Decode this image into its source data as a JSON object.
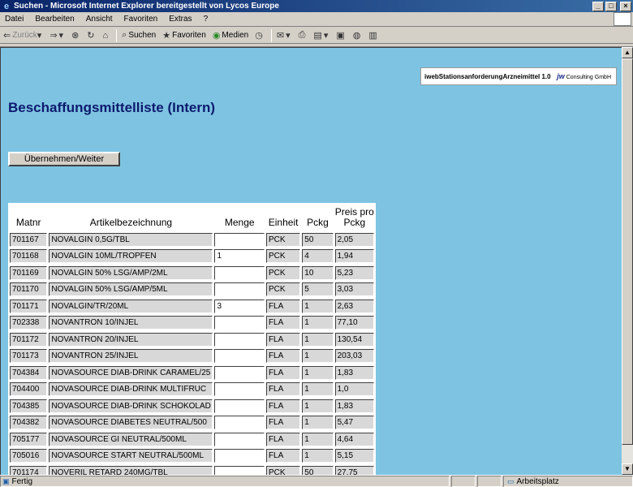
{
  "window": {
    "title": "Suchen - Microsoft Internet Explorer bereitgestellt von Lycos Europe",
    "min_label": "_",
    "max_label": "□",
    "close_label": "×"
  },
  "menubar": [
    "Datei",
    "Bearbeiten",
    "Ansicht",
    "Favoriten",
    "Extras",
    "?"
  ],
  "toolbar": {
    "back": "Zurück",
    "search": "Suchen",
    "favorites": "Favoriten",
    "media": "Medien"
  },
  "banner": {
    "text": "iwebStationsanforderungArzneimittel 1.0",
    "logo_mark": "jw",
    "logo_text": "Consulting GmbH"
  },
  "page": {
    "title": "Beschaffungsmittelliste (Intern)",
    "submit_label": "Übernehmen/Weiter"
  },
  "table": {
    "headers": {
      "matnr": "Matnr",
      "artikel": "Artikelbezeichnung",
      "menge": "Menge",
      "einheit": "Einheit",
      "pckg": "Pckg",
      "preis": "Preis pro Pckg"
    },
    "rows": [
      {
        "matnr": "701167",
        "artikel": "NOVALGIN 0,5G/TBL",
        "menge": "",
        "einheit": "PCK",
        "pckg": "50",
        "preis": "2,05"
      },
      {
        "matnr": "701168",
        "artikel": "NOVALGIN 10ML/TROPFEN",
        "menge": "1",
        "einheit": "PCK",
        "pckg": "4",
        "preis": "1,94"
      },
      {
        "matnr": "701169",
        "artikel": "NOVALGIN 50% LSG/AMP/2ML",
        "menge": "",
        "einheit": "PCK",
        "pckg": "10",
        "preis": "5,23"
      },
      {
        "matnr": "701170",
        "artikel": "NOVALGIN 50% LSG/AMP/5ML",
        "menge": "",
        "einheit": "PCK",
        "pckg": "5",
        "preis": "3,03"
      },
      {
        "matnr": "701171",
        "artikel": "NOVALGIN/TR/20ML",
        "menge": "3",
        "einheit": "FLA",
        "pckg": "1",
        "preis": "2,63"
      },
      {
        "matnr": "702338",
        "artikel": "NOVANTRON 10/INJEL",
        "menge": "",
        "einheit": "FLA",
        "pckg": "1",
        "preis": "77,10"
      },
      {
        "matnr": "701172",
        "artikel": "NOVANTRON 20/INJEL",
        "menge": "",
        "einheit": "FLA",
        "pckg": "1",
        "preis": "130,54"
      },
      {
        "matnr": "701173",
        "artikel": "NOVANTRON 25/INJEL",
        "menge": "",
        "einheit": "FLA",
        "pckg": "1",
        "preis": "203,03"
      },
      {
        "matnr": "704384",
        "artikel": "NOVASOURCE DIAB-DRINK CARAMEL/25",
        "menge": "",
        "einheit": "FLA",
        "pckg": "1",
        "preis": "1,83"
      },
      {
        "matnr": "704400",
        "artikel": "NOVASOURCE DIAB-DRINK MULTIFRUC",
        "menge": "",
        "einheit": "FLA",
        "pckg": "1",
        "preis": "1,0"
      },
      {
        "matnr": "704385",
        "artikel": "NOVASOURCE DIAB-DRINK SCHOKOLAD",
        "menge": "",
        "einheit": "FLA",
        "pckg": "1",
        "preis": "1,83"
      },
      {
        "matnr": "704382",
        "artikel": "NOVASOURCE DIABETES NEUTRAL/500",
        "menge": "",
        "einheit": "FLA",
        "pckg": "1",
        "preis": "5,47"
      },
      {
        "matnr": "705177",
        "artikel": "NOVASOURCE GI NEUTRAL/500ML",
        "menge": "",
        "einheit": "FLA",
        "pckg": "1",
        "preis": "4,64"
      },
      {
        "matnr": "705016",
        "artikel": "NOVASOURCE START NEUTRAL/500ML",
        "menge": "",
        "einheit": "FLA",
        "pckg": "1",
        "preis": "5,15"
      },
      {
        "matnr": "701174",
        "artikel": "NOVERIL RETARD 240MG/TBL",
        "menge": "",
        "einheit": "PCK",
        "pckg": "50",
        "preis": "27,75"
      }
    ]
  },
  "status": {
    "left": "Fertig",
    "zone": "Arbeitsplatz"
  }
}
